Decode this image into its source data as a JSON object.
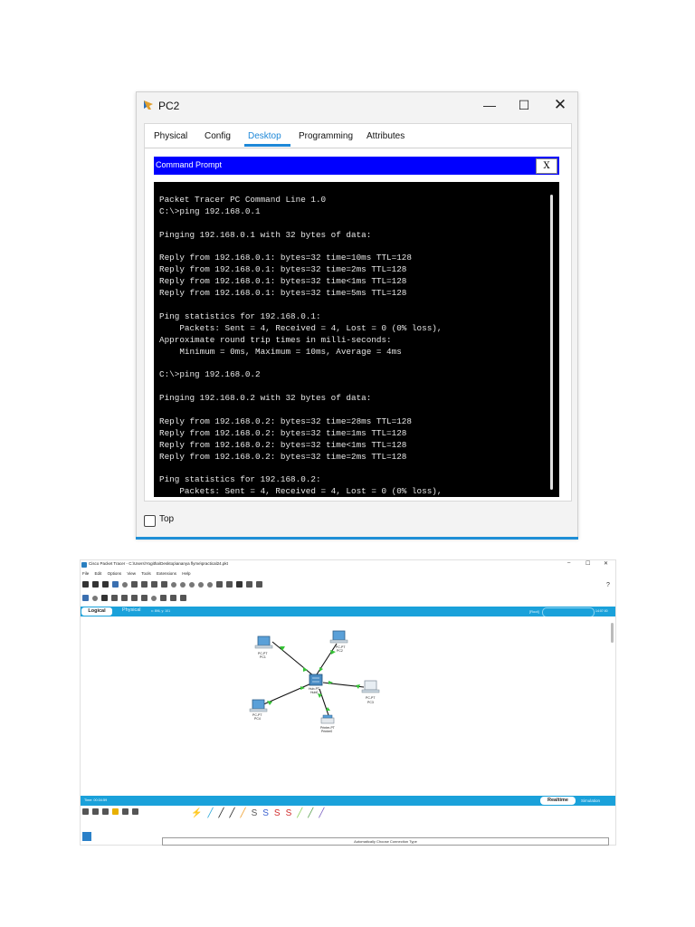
{
  "pc2_window": {
    "title": "PC2",
    "controls": {
      "minimize": "—",
      "maximize": "☐",
      "close": "✕"
    },
    "tabs": [
      {
        "label": "Physical",
        "active": false
      },
      {
        "label": "Config",
        "active": false
      },
      {
        "label": "Desktop",
        "active": true
      },
      {
        "label": "Programming",
        "active": false
      },
      {
        "label": "Attributes",
        "active": false
      }
    ],
    "command_prompt": {
      "title": "Command Prompt",
      "close_label": "X",
      "lines": [
        "Packet Tracer PC Command Line 1.0",
        "C:\\>ping 192.168.0.1",
        "",
        "Pinging 192.168.0.1 with 32 bytes of data:",
        "",
        "Reply from 192.168.0.1: bytes=32 time=10ms TTL=128",
        "Reply from 192.168.0.1: bytes=32 time=2ms TTL=128",
        "Reply from 192.168.0.1: bytes=32 time<1ms TTL=128",
        "Reply from 192.168.0.1: bytes=32 time=5ms TTL=128",
        "",
        "Ping statistics for 192.168.0.1:",
        "    Packets: Sent = 4, Received = 4, Lost = 0 (0% loss),",
        "Approximate round trip times in milli-seconds:",
        "    Minimum = 0ms, Maximum = 10ms, Average = 4ms",
        "",
        "C:\\>ping 192.168.0.2",
        "",
        "Pinging 192.168.0.2 with 32 bytes of data:",
        "",
        "Reply from 192.168.0.2: bytes=32 time=28ms TTL=128",
        "Reply from 192.168.0.2: bytes=32 time=1ms TTL=128",
        "Reply from 192.168.0.2: bytes=32 time<1ms TTL=128",
        "Reply from 192.168.0.2: bytes=32 time=2ms TTL=128",
        "",
        "Ping statistics for 192.168.0.2:",
        "    Packets: Sent = 4, Received = 4, Lost = 0 (0% loss),"
      ]
    },
    "top_checkbox": {
      "label": "Top",
      "checked": false
    },
    "colors": {
      "accent": "#1e88d8",
      "cmd_header": "#0000ff",
      "terminal_bg": "#000000"
    }
  },
  "packet_tracer": {
    "title": "Cisco Packet Tracer - C:\\Users\\Yogitha\\Desktop\\ananya flyme\\practical24.pkt",
    "controls": {
      "minimize": "–",
      "maximize": "☐",
      "close": "✕"
    },
    "menu": [
      "File",
      "Edit",
      "Options",
      "View",
      "Tools",
      "Extensions",
      "Help"
    ],
    "help_label": "?",
    "workspace": {
      "logical": "Logical",
      "physical": "Physical",
      "coords": "x: 896, y: 101",
      "root": "[Root]",
      "clock": "14:07:00"
    },
    "time_label": "Time: 00:34:59",
    "realtime_label": "Realtime",
    "simulation_label": "Simulation",
    "connection_type_label": "Automatically Choose Connection Type",
    "devices": [
      {
        "id": "pc1",
        "type": "PC-PT",
        "name": "PC1"
      },
      {
        "id": "pc2",
        "type": "PC-PT",
        "name": "PC2"
      },
      {
        "id": "pc3",
        "type": "PC-PT",
        "name": "PC3"
      },
      {
        "id": "pc4",
        "type": "PC-PT",
        "name": "PC4"
      },
      {
        "id": "hub",
        "type": "Hub-PT",
        "name": "Hub0"
      },
      {
        "id": "printer",
        "type": "Printer-PT",
        "name": "Printer0"
      }
    ],
    "colors": {
      "bar": "#1aa1da",
      "link": "#111111",
      "link_status": "#35c235"
    }
  }
}
